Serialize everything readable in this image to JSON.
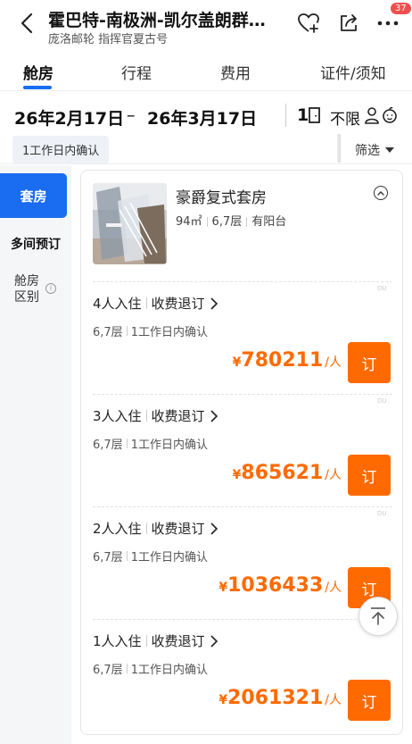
{
  "header": {
    "title": "霍巴特-南极洲-凯尔盖朗群…",
    "subtitle": "庞洛邮轮 指挥官夏古号",
    "badge": "37"
  },
  "tabs": [
    "舱房",
    "行程",
    "费用",
    "证件/须知"
  ],
  "dates": {
    "start": "26年2月17日",
    "dash": "–",
    "end": "26年3月17日",
    "guests": "1",
    "unlimited": "不限"
  },
  "filter": {
    "confirm_chip": "1工作日内确认",
    "filter_label": "筛选"
  },
  "leftnav": {
    "active": "套房",
    "multi": "多间预订",
    "diff": "舱房区别"
  },
  "cabin": {
    "name": "豪爵复式套房",
    "area": "94㎡",
    "floors": "6,7层",
    "balcony": "有阳台"
  },
  "offers": [
    {
      "occupancy": "4人入住",
      "policy": "收费退订",
      "floors": "6,7层",
      "confirm": "1工作日内确认",
      "currency": "¥",
      "price": "780211",
      "unit": "/人",
      "book": "订",
      "du": "DU"
    },
    {
      "occupancy": "3人入住",
      "policy": "收费退订",
      "floors": "6,7层",
      "confirm": "1工作日内确认",
      "currency": "¥",
      "price": "865621",
      "unit": "/人",
      "book": "订",
      "du": "DU"
    },
    {
      "occupancy": "2人入住",
      "policy": "收费退订",
      "floors": "6,7层",
      "confirm": "1工作日内确认",
      "currency": "¥",
      "price": "1036433",
      "unit": "/人",
      "book": "订",
      "du": "DU"
    },
    {
      "occupancy": "1人入住",
      "policy": "收费退订",
      "floors": "6,7层",
      "confirm": "1工作日内确认",
      "currency": "¥",
      "price": "2061321",
      "unit": "/人",
      "book": "订",
      "du": ""
    }
  ],
  "colors": {
    "accent": "#1a6cf0",
    "price": "#ff6a00",
    "badge": "#ef4e4e"
  }
}
